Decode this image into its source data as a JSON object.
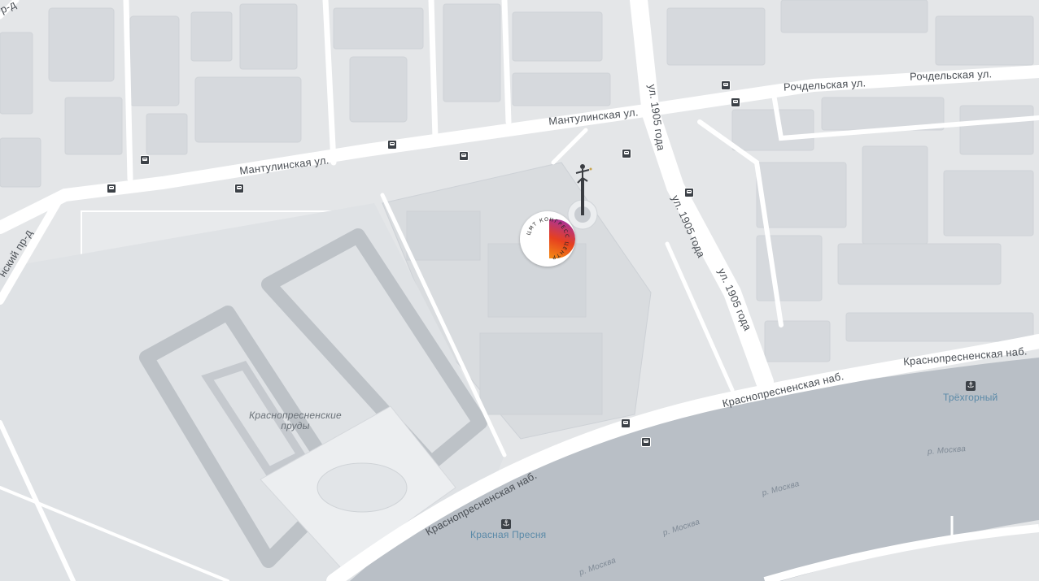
{
  "colors": {
    "land": "#e4e6e8",
    "block": "#eceef0",
    "building": "#d6d9dd",
    "building_dark": "#c9cdd2",
    "road": "#ffffff",
    "water": "#b9bfc6",
    "park": "#dde0e3",
    "accent_gradient": [
      "#9b2fb5",
      "#e6401f",
      "#f58c15"
    ],
    "pier_text": "#5b8aa8"
  },
  "streets": {
    "rochdelskaya_1": "Рочдельская ул.",
    "rochdelskaya_2": "Рочдельская ул.",
    "mantulinskaya_1": "Мантулинская ул.",
    "mantulinskaya_2": "Мантулинская ул.",
    "ul1905_1": "ул. 1905 года",
    "ul1905_2": "ул. 1905 года",
    "ul1905_3": "ул. 1905 года",
    "krasnopresnenskaya_1": "Краснопресненская наб.",
    "krasnopresnenskaya_2": "Краснопресненская наб.",
    "krasnopresnenskaya_3": "Краснопресненская наб.",
    "proezd_top": "р-д",
    "proezd_left": "нский пр-д"
  },
  "water": {
    "river_1": "р. Москва",
    "river_2": "р. Москва",
    "river_3": "р. Москва",
    "river_4": "р. Москва"
  },
  "places": {
    "ponds": "Краснопресненские пруды",
    "pier_krasnaya_presnya": "Красная Пресня",
    "pier_trekhgorny": "Трёхгорный",
    "poi_ring_text": "ЦМТ КОНГРЕСС ЦЕНТР"
  },
  "icons": {
    "bus_stop": "bus-stop-icon",
    "pier": "anchor-icon",
    "monument": "monument-icon",
    "poi": "congress-center-logo"
  }
}
